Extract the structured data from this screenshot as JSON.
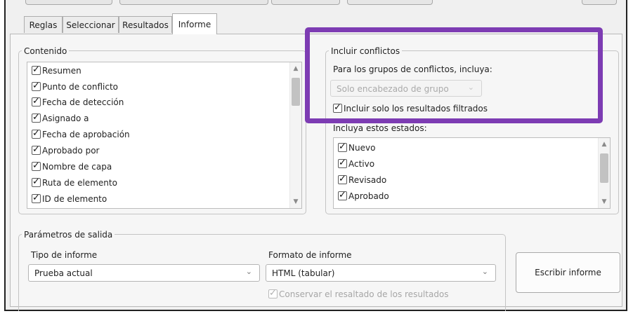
{
  "tabs": [
    {
      "label": "Reglas",
      "active": false
    },
    {
      "label": "Seleccionar",
      "active": false
    },
    {
      "label": "Resultados",
      "active": false
    },
    {
      "label": "Informe",
      "active": true
    }
  ],
  "content": {
    "legend": "Contenido",
    "items": [
      {
        "label": "Resumen",
        "checked": true
      },
      {
        "label": "Punto de conflicto",
        "checked": true
      },
      {
        "label": "Fecha de detección",
        "checked": true
      },
      {
        "label": "Asignado a",
        "checked": true
      },
      {
        "label": "Fecha de aprobación",
        "checked": true
      },
      {
        "label": "Aprobado por",
        "checked": true
      },
      {
        "label": "Nombre de capa",
        "checked": true
      },
      {
        "label": "Ruta de elemento",
        "checked": true
      },
      {
        "label": "ID de elemento",
        "checked": true
      }
    ]
  },
  "conflicts": {
    "legend": "Incluir conflictos",
    "groups_label": "Para los grupos de conflictos, incluya:",
    "groups_select": "Solo encabezado de grupo",
    "filtered_checkbox": {
      "label": "Incluir solo los resultados filtrados",
      "checked": true
    },
    "states_label": "Incluya estos estados:",
    "states": [
      {
        "label": "Nuevo",
        "checked": true
      },
      {
        "label": "Activo",
        "checked": true
      },
      {
        "label": "Revisado",
        "checked": true
      },
      {
        "label": "Aprobado",
        "checked": true
      }
    ]
  },
  "output": {
    "legend": "Parámetros de salida",
    "report_type_label": "Tipo de informe",
    "report_type_value": "Prueba actual",
    "report_format_label": "Formato de informe",
    "report_format_value": "HTML (tabular)",
    "keep_highlight": {
      "label": "Conservar el resaltado de los resultados",
      "checked": true,
      "enabled": false
    },
    "write_button": "Escribir informe"
  },
  "colors": {
    "highlight_border": "#7d3cb3",
    "panel_bg": "#f6f6f6"
  }
}
